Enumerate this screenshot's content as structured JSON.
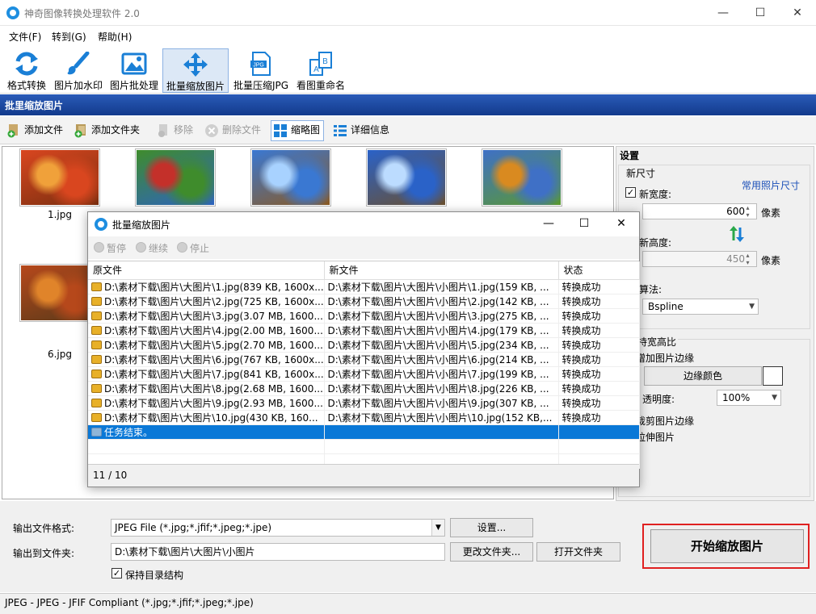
{
  "window": {
    "title": "神奇图像转换处理软件 2.0",
    "minimize": "—",
    "maximize": "☐",
    "close": "✕"
  },
  "menu": [
    "文件(F)",
    "转到(G)",
    "帮助(H)"
  ],
  "toolbar": [
    "格式转换",
    "图片加水印",
    "图片批处理",
    "批量缩放图片",
    "批量压缩JPG",
    "看图重命名"
  ],
  "toolbar_selected_index": 3,
  "toolbar_jpg_badge": "JPG",
  "toolbar_rename_letters": [
    "A",
    "B"
  ],
  "section_header": "批里缩放图片",
  "filebar": {
    "add_file": "添加文件",
    "add_folder": "添加文件夹",
    "remove": "移除",
    "delete_file": "删除文件",
    "thumbnail": "缩略图",
    "details": "详细信息"
  },
  "thumbnails": [
    {
      "label": "1.jpg",
      "colors": [
        "#d9461f",
        "#f0a13a",
        "#7a2f10"
      ]
    },
    {
      "label": "",
      "colors": [
        "#3f8c2c",
        "#c4302a",
        "#2e64c0"
      ]
    },
    {
      "label": "",
      "colors": [
        "#3a78d2",
        "#a8d2ff",
        "#8b5a22"
      ]
    },
    {
      "label": "",
      "colors": [
        "#2a62c8",
        "#bcdcff",
        "#6a5030"
      ]
    },
    {
      "label": "",
      "colors": [
        "#3f70c6",
        "#d98a20",
        "#5a9a30"
      ]
    },
    {
      "label": "6.jpg",
      "colors": [
        "#b6481b",
        "#e0842a",
        "#5a3a1a"
      ]
    }
  ],
  "settings": {
    "title": "设置",
    "new_size": "新尺寸",
    "common_sizes": "常用照片尺寸",
    "new_width_label": "新宽度:",
    "new_width_value": "600",
    "new_height_label": "新高度:",
    "new_height_value": "450",
    "unit_px": "像素",
    "algorithm_label": "算法:",
    "algorithm_value": "Bspline",
    "aspect_label": "持宽高比",
    "add_border": "增加图片边缘",
    "border_color_button": "边缘颜色",
    "border_color": "#ffffff",
    "opacity_label": "透明度:",
    "opacity_value": "100%",
    "crop_border": "裁剪图片边缘",
    "stretch": "拉伸图片"
  },
  "bottom": {
    "output_format_label": "输出文件格式:",
    "output_format_value": "JPEG File (*.jpg;*.jfif;*.jpeg;*.jpe)",
    "settings_button": "设置...",
    "output_dir_label": "输出到文件夹:",
    "output_dir_value": "D:\\素材下载\\图片\\大图片\\小图片",
    "change_folder_button": "更改文件夹...",
    "open_folder_button": "打开文件夹",
    "keep_structure": "保持目录结构",
    "start_button": "开始缩放图片"
  },
  "statusbar": "JPEG - JPEG - JFIF Compliant (*.jpg;*.jfif;*.jpeg;*.jpe)",
  "dialog": {
    "title": "批量缩放图片",
    "minimize": "—",
    "maximize": "☐",
    "close": "✕",
    "pause": "暂停",
    "resume": "继续",
    "stop": "停止",
    "columns": [
      "原文件",
      "新文件",
      "状态"
    ],
    "rows": [
      [
        "D:\\素材下载\\图片\\大图片\\1.jpg(839 KB, 1600x...",
        "D:\\素材下载\\图片\\大图片\\小图片\\1.jpg(159 KB, ...",
        "转换成功"
      ],
      [
        "D:\\素材下载\\图片\\大图片\\2.jpg(725 KB, 1600x...",
        "D:\\素材下载\\图片\\大图片\\小图片\\2.jpg(142 KB, ...",
        "转换成功"
      ],
      [
        "D:\\素材下载\\图片\\大图片\\3.jpg(3.07 MB, 1600...",
        "D:\\素材下载\\图片\\大图片\\小图片\\3.jpg(275 KB, ...",
        "转换成功"
      ],
      [
        "D:\\素材下载\\图片\\大图片\\4.jpg(2.00 MB, 1600...",
        "D:\\素材下载\\图片\\大图片\\小图片\\4.jpg(179 KB, ...",
        "转换成功"
      ],
      [
        "D:\\素材下载\\图片\\大图片\\5.jpg(2.70 MB, 1600...",
        "D:\\素材下载\\图片\\大图片\\小图片\\5.jpg(234 KB, ...",
        "转换成功"
      ],
      [
        "D:\\素材下载\\图片\\大图片\\6.jpg(767 KB, 1600x...",
        "D:\\素材下载\\图片\\大图片\\小图片\\6.jpg(214 KB, ...",
        "转换成功"
      ],
      [
        "D:\\素材下载\\图片\\大图片\\7.jpg(841 KB, 1600x...",
        "D:\\素材下载\\图片\\大图片\\小图片\\7.jpg(199 KB, ...",
        "转换成功"
      ],
      [
        "D:\\素材下载\\图片\\大图片\\8.jpg(2.68 MB, 1600...",
        "D:\\素材下载\\图片\\大图片\\小图片\\8.jpg(226 KB, ...",
        "转换成功"
      ],
      [
        "D:\\素材下载\\图片\\大图片\\9.jpg(2.93 MB, 1600...",
        "D:\\素材下载\\图片\\大图片\\小图片\\9.jpg(307 KB, ...",
        "转换成功"
      ],
      [
        "D:\\素材下载\\图片\\大图片\\10.jpg(430 KB, 160...",
        "D:\\素材下载\\图片\\大图片\\小图片\\10.jpg(152 KB,...",
        "转换成功"
      ],
      [
        "任务结束。",
        "",
        ""
      ]
    ],
    "status": "11 / 10"
  },
  "colors": {
    "accent_blue": "#0a78d7",
    "header_blue": "#1f4aa0",
    "start_highlight": "#e02020"
  }
}
